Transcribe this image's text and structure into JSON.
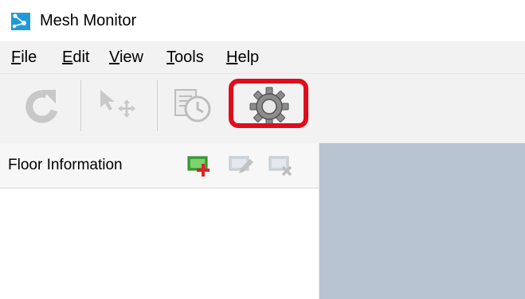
{
  "window": {
    "title": "Mesh Monitor",
    "icon": "mesh-network-app-icon"
  },
  "menu": [
    {
      "label": "File",
      "accel": "F",
      "rest": "ile"
    },
    {
      "label": "Edit",
      "accel": "E",
      "rest": "dit"
    },
    {
      "label": "View",
      "accel": "V",
      "rest": "iew"
    },
    {
      "label": "Tools",
      "accel": "T",
      "rest": "ools"
    },
    {
      "label": "Help",
      "accel": "H",
      "rest": "elp"
    }
  ],
  "toolbar": {
    "buttons": [
      {
        "icon": "refresh-icon",
        "enabled": false
      },
      {
        "icon": "move-cursor-icon",
        "enabled": false
      },
      {
        "icon": "history-clock-icon",
        "enabled": false
      },
      {
        "icon": "gear-icon",
        "enabled": true,
        "highlighted": true
      }
    ],
    "highlight_color": "#e10c1b"
  },
  "floor_panel": {
    "title": "Floor Information",
    "buttons": [
      {
        "icon": "add-floor-icon",
        "enabled": true
      },
      {
        "icon": "edit-floor-icon",
        "enabled": false
      },
      {
        "icon": "delete-floor-icon",
        "enabled": false
      }
    ]
  },
  "colors": {
    "map_background": "#b9c4d2",
    "toolbar_background": "#f2f2f2",
    "add_green": "#3aa535",
    "add_red_plus": "#e0202a"
  }
}
